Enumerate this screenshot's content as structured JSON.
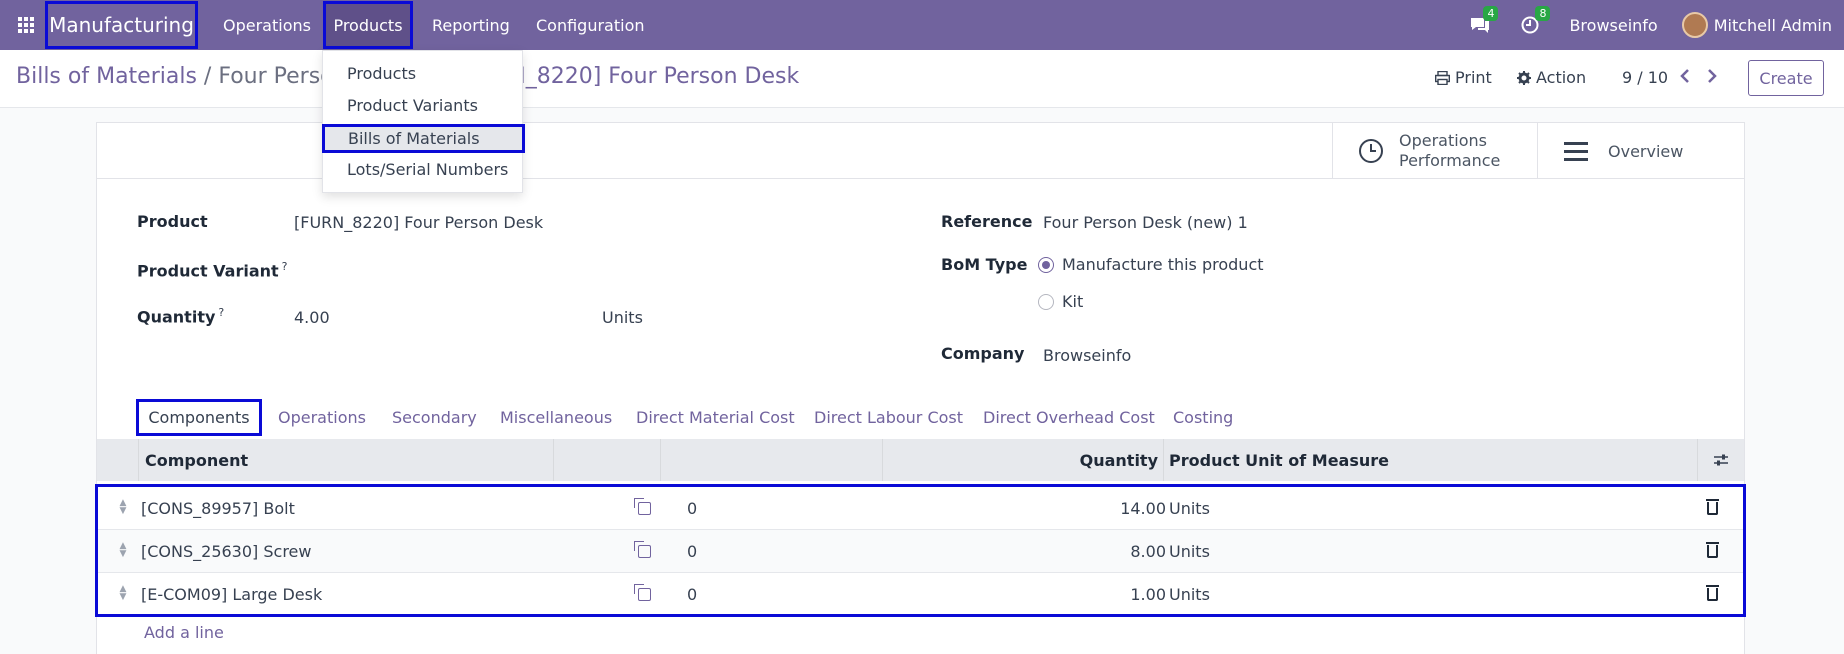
{
  "navbar": {
    "app_name": "Manufacturing",
    "menu": [
      "Operations",
      "Products",
      "Reporting",
      "Configuration"
    ],
    "messages_count": "4",
    "activities_count": "8",
    "company": "Browseinfo",
    "user": "Mitchell Admin"
  },
  "products_menu": {
    "items": [
      "Products",
      "Product Variants",
      "Bills of Materials",
      "Lots/Serial Numbers"
    ]
  },
  "control": {
    "breadcrumb_root": "Bills of Materials",
    "breadcrumb_sep": "/",
    "breadcrumb_current_left": "Four Perso",
    "breadcrumb_current_right": "RN_8220] Four Person Desk",
    "print_label": "Print",
    "action_label": "Action",
    "pager": "9 / 10",
    "create_label": "Create"
  },
  "smart_buttons": {
    "ops_perf_line1": "Operations",
    "ops_perf_line2": "Performance",
    "overview": "Overview"
  },
  "form": {
    "product_label": "Product",
    "product_value": "[FURN_8220] Four Person Desk",
    "variant_label": "Product Variant",
    "help_mark": "?",
    "quantity_label": "Quantity",
    "quantity_value": "4.00",
    "quantity_uom": "Units",
    "reference_label": "Reference",
    "reference_value": "Four Person Desk (new) 1",
    "bom_type_label": "BoM Type",
    "bom_type_options": [
      "Manufacture this product",
      "Kit"
    ],
    "company_label": "Company",
    "company_value": "Browseinfo"
  },
  "tabs": [
    "Components",
    "Operations",
    "Secondary",
    "Miscellaneous",
    "Direct Material Cost",
    "Direct Labour Cost",
    "Direct Overhead Cost",
    "Costing"
  ],
  "table": {
    "headers": {
      "component": "Component",
      "quantity": "Quantity",
      "uom": "Product Unit of Measure"
    },
    "rows": [
      {
        "component": "[CONS_89957] Bolt",
        "count": "0",
        "quantity": "14.00",
        "uom": "Units"
      },
      {
        "component": "[CONS_25630] Screw",
        "count": "0",
        "quantity": "8.00",
        "uom": "Units"
      },
      {
        "component": "[E-COM09] Large Desk",
        "count": "0",
        "quantity": "1.00",
        "uom": "Units"
      }
    ],
    "add_line": "Add a line"
  }
}
